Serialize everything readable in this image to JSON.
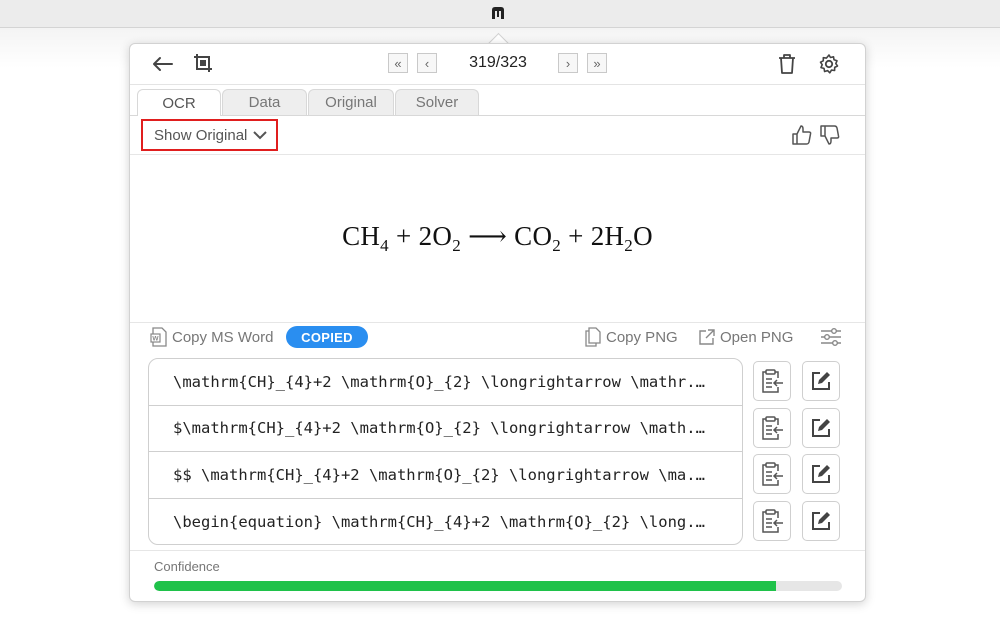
{
  "header": {
    "back_icon": "arrow-left-icon",
    "crop_icon": "crop-screen-icon",
    "page_counter": "319/323",
    "first_icon": "double-chevron-left-icon",
    "prev_icon": "chevron-left-icon",
    "next_icon": "chevron-right-icon",
    "last_icon": "double-chevron-right-icon",
    "delete_icon": "trash-icon",
    "settings_icon": "gear-icon"
  },
  "tabs": [
    {
      "label": "OCR",
      "active": true
    },
    {
      "label": "Data",
      "active": false
    },
    {
      "label": "Original",
      "active": false
    },
    {
      "label": "Solver",
      "active": false
    }
  ],
  "show_original": {
    "label": "Show Original"
  },
  "feedback": {
    "up_icon": "thumbs-up-icon",
    "down_icon": "thumbs-down-icon"
  },
  "preview": {
    "parts": [
      "CH",
      "4",
      " + 2O",
      "2",
      " ⟶ CO",
      "2",
      " + 2H",
      "2",
      "O"
    ]
  },
  "actions": {
    "copy_ms_word": "Copy MS Word",
    "copied_badge": "COPIED",
    "copy_png": "Copy PNG",
    "open_png": "Open PNG"
  },
  "results": [
    "\\mathrm{CH}_{4}+2 \\mathrm{O}_{2} \\longrightarrow \\mathr...",
    "$\\mathrm{CH}_{4}+2 \\mathrm{O}_{2} \\longrightarrow \\math...",
    "$$ \\mathrm{CH}_{4}+2 \\mathrm{O}_{2} \\longrightarrow \\ma...",
    "\\begin{equation} \\mathrm{CH}_{4}+2 \\mathrm{O}_{2} \\long..."
  ],
  "confidence": {
    "label": "Confidence",
    "value": 0.904
  },
  "colors": {
    "accent": "#2a8ef0",
    "confidence_fill": "#1fc24a",
    "highlight_border": "#e01e1e"
  }
}
